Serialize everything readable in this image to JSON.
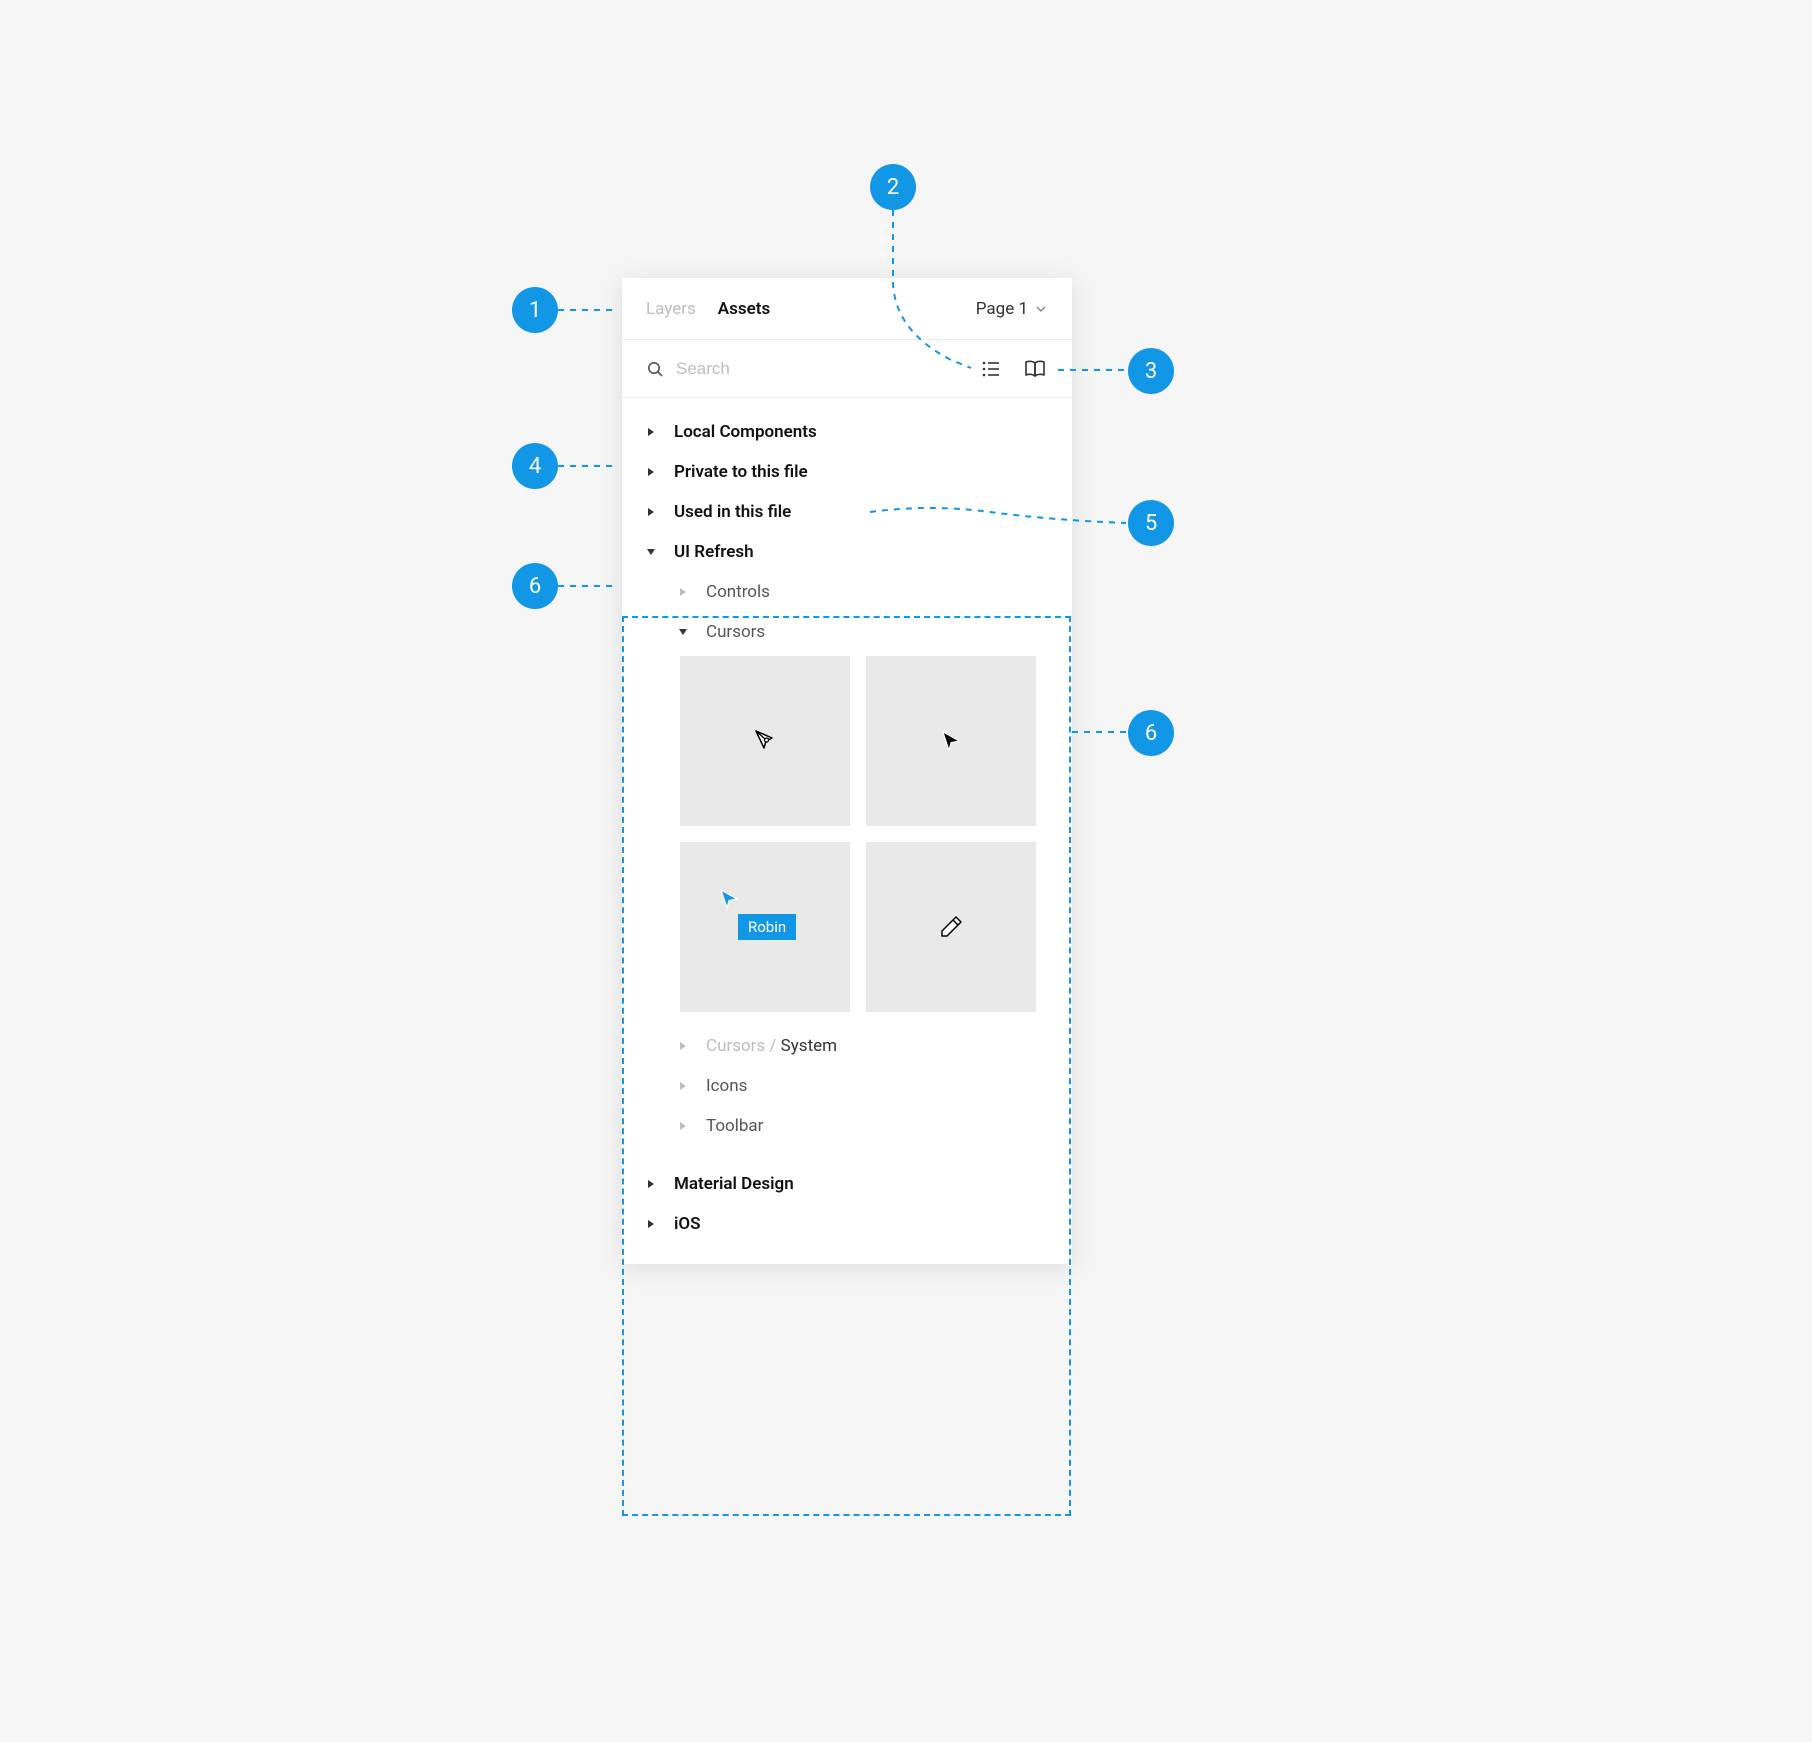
{
  "tabs": {
    "layers": "Layers",
    "assets": "Assets"
  },
  "page_select": "Page 1",
  "search": {
    "placeholder": "Search"
  },
  "sections": {
    "local_components": "Local Components",
    "private_to_file": "Private to this file",
    "used_in_file": "Used in this file",
    "ui_refresh": "UI Refresh",
    "controls": "Controls",
    "cursors": "Cursors",
    "cursors_system_prefix": "Cursors / ",
    "cursors_system_suffix": "System",
    "icons": "Icons",
    "toolbar": "Toolbar",
    "material_design": "Material Design",
    "ios": "iOS"
  },
  "cursor_user": "Robin",
  "callouts": {
    "c1": "1",
    "c2": "2",
    "c3": "3",
    "c4": "4",
    "c5": "5",
    "c6": "6"
  }
}
